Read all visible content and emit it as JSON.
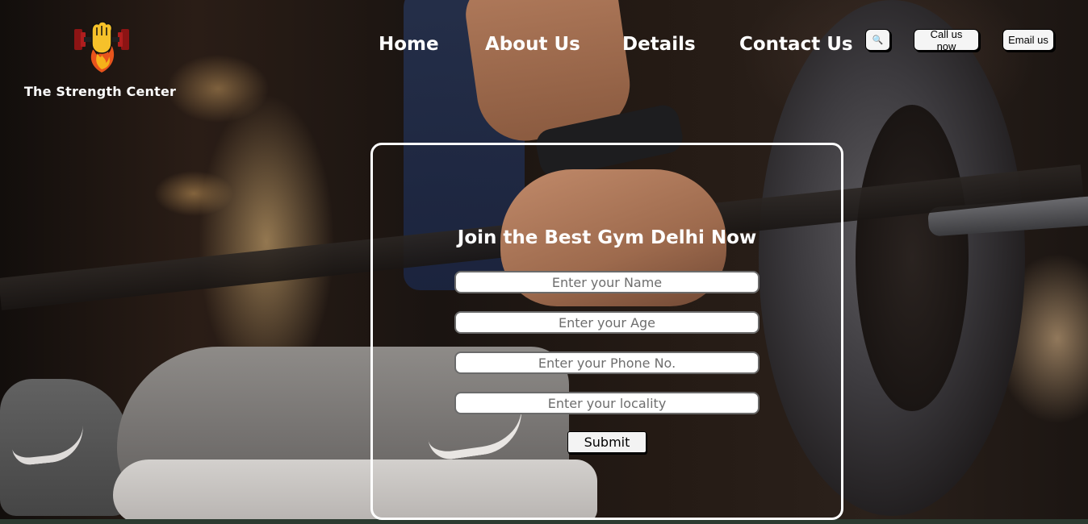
{
  "brand": {
    "name": "The Strength Center",
    "logo_icon": "fist-dumbbell-flame-icon"
  },
  "nav": {
    "items": [
      {
        "label": "Home"
      },
      {
        "label": "About Us"
      },
      {
        "label": "Details"
      },
      {
        "label": "Contact Us"
      }
    ]
  },
  "header_actions": {
    "search_icon": "search-icon",
    "search_glyph": "🔍",
    "call_label": "Call us now",
    "email_label": "Email us"
  },
  "form": {
    "title": "Join the Best Gym Delhi Now",
    "fields": [
      {
        "placeholder": "Enter your Name",
        "value": ""
      },
      {
        "placeholder": "Enter your Age",
        "value": ""
      },
      {
        "placeholder": "Enter your Phone No.",
        "value": ""
      },
      {
        "placeholder": "Enter your locality",
        "value": ""
      }
    ],
    "submit_label": "Submit"
  },
  "colors": {
    "text": "#ffffff",
    "form_border": "#ffffff",
    "button_bg": "#f5f5f5"
  }
}
